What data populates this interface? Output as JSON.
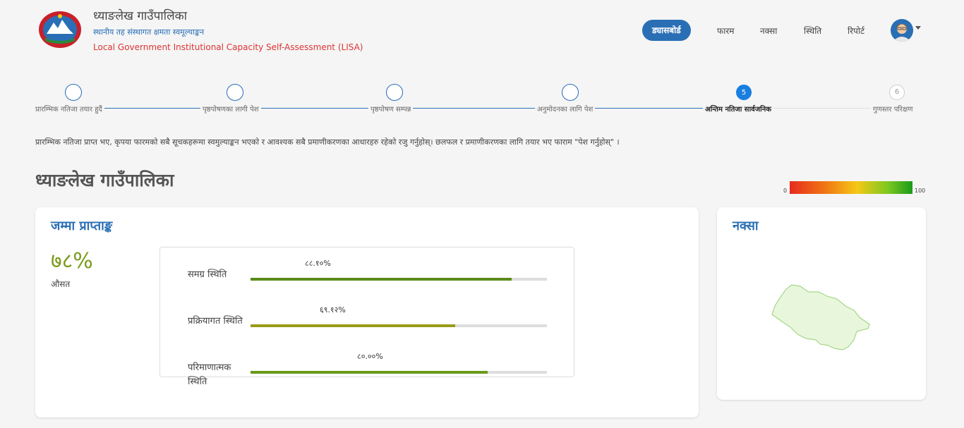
{
  "header": {
    "title": "ध्याङलेख गाउँपालिका",
    "subtitle_np": "स्थानीय तह संस्थागत क्षमता स्वमूल्याङ्कन",
    "subtitle_en": "Local Government Institutional Capacity Self-Assessment (LISA)"
  },
  "nav": {
    "items": [
      {
        "label": "ड्यासबोर्ड",
        "active": true
      },
      {
        "label": "फारम"
      },
      {
        "label": "नक्सा"
      },
      {
        "label": "स्थिति"
      },
      {
        "label": "रिपोर्ट"
      }
    ]
  },
  "stepper": {
    "steps": [
      {
        "number": "",
        "label": "प्रारम्भिक नतिजा तयार हुदैं",
        "state": "done"
      },
      {
        "number": "",
        "label": "पृष्ठपोषणका लागी पेश",
        "state": "done"
      },
      {
        "number": "",
        "label": "पृष्ठपोषण सम्पन्न",
        "state": "done"
      },
      {
        "number": "",
        "label": "अनुमोदनका लागि पेश",
        "state": "done"
      },
      {
        "number": "5",
        "label": "अन्तिम नतिजा सार्वजनिक",
        "state": "active"
      },
      {
        "number": "6",
        "label": "गुणस्तर परिक्षण",
        "state": "pending"
      }
    ]
  },
  "instruction": "प्रारम्भिक नतिजा प्राप्त भए, कृपया फारमको सबै सूचकहरूमा स्वमुल्याङ्कन भएको र आवश्यक सबै प्रमाणीकरणका आधारहरु रहेको रजु गर्नुहोस्। छलफल र प्रमाणीकरणका लागि तयार भए फाराम \"पेश गर्नुहोस्\" ।",
  "page_title": "ध्याङलेख गाउँपालिका",
  "legend": {
    "min": "0",
    "max": "100"
  },
  "score_card": {
    "title": "जम्मा प्राप्ताङ्क",
    "score": "७८%",
    "score_label": "औसत",
    "bars": [
      {
        "label": "समग्र स्थिति",
        "value_text": "८८.१०%",
        "fraction": 0.881,
        "color": "#5a8a1a"
      },
      {
        "label": "प्रक्रियागत स्थिति",
        "value_text": "६९.१२%",
        "fraction": 0.6912,
        "color": "#9a9a1a"
      },
      {
        "label": "परिमाणात्मक स्थिति",
        "value_text": "८०.००%",
        "fraction": 0.8,
        "color": "#6a9a1a"
      }
    ]
  },
  "map_card": {
    "title": "नक्सा",
    "fill_color": "#e8f7dc",
    "stroke_color": "#a6d68a"
  }
}
